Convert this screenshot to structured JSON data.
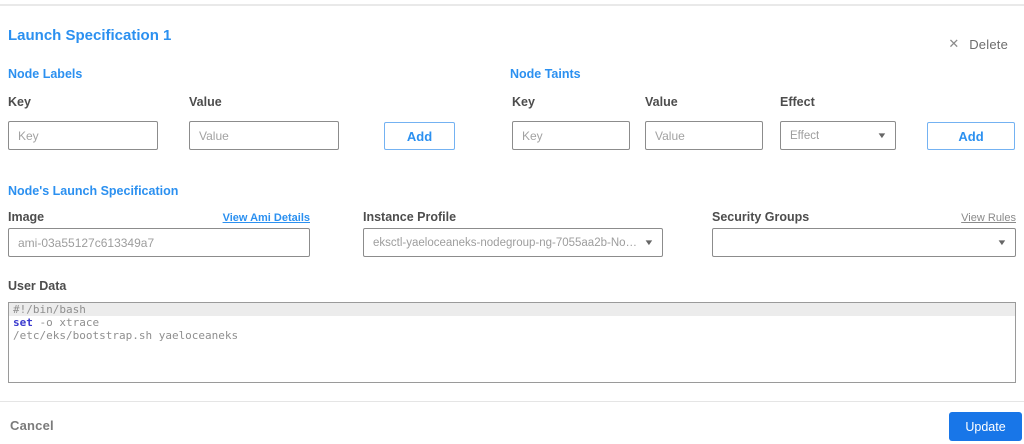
{
  "header": {
    "title": "Launch Specification 1",
    "delete_label": "Delete",
    "delete_icon": "✕"
  },
  "node_labels": {
    "section_title": "Node Labels",
    "key_label": "Key",
    "key_placeholder": "Key",
    "value_label": "Value",
    "value_placeholder": "Value",
    "add_label": "Add"
  },
  "node_taints": {
    "section_title": "Node Taints",
    "key_label": "Key",
    "key_placeholder": "Key",
    "value_label": "Value",
    "value_placeholder": "Value",
    "effect_label": "Effect",
    "effect_placeholder": "Effect",
    "add_label": "Add",
    "caret_icon": "▼"
  },
  "launch_spec": {
    "section_title": "Node's Launch Specification",
    "image_label": "Image",
    "view_ami_link": "View Ami Details",
    "image_value": "ami-03a55127c613349a7",
    "instance_profile_label": "Instance Profile",
    "instance_profile_value": "eksctl-yaeloceaneks-nodegroup-ng-7055aa2b-NodeInstanceProfile-...",
    "security_groups_label": "Security Groups",
    "view_rules_link": "View Rules",
    "security_groups_value": "",
    "caret_icon": "▼"
  },
  "user_data": {
    "label": "User Data",
    "line1": "#!/bin/bash",
    "line2_keyword": "set",
    "line2_rest": " -o xtrace",
    "line3": "/etc/eks/bootstrap.sh yaeloceaneks"
  },
  "footer": {
    "cancel_label": "Cancel",
    "update_label": "Update"
  },
  "colors": {
    "accent_blue": "#2b90f0",
    "update_button_blue": "#1876e8",
    "keyword_blue": "#3a3ace",
    "border_gray": "#8c8c8c",
    "text_gray": "#6d6d6d",
    "active_line_bg": "#ececec"
  }
}
